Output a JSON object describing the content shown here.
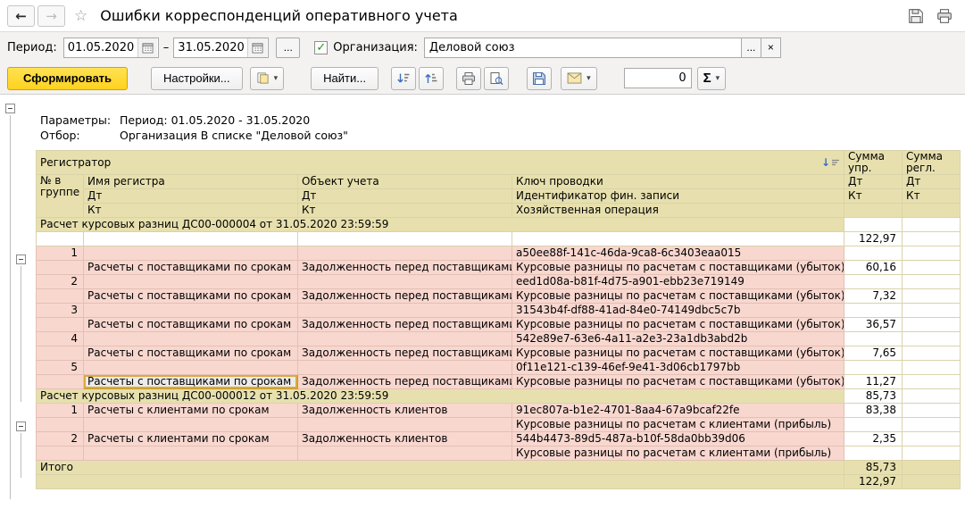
{
  "window": {
    "title": "Ошибки корреспонденций оперативного учета"
  },
  "icons": {
    "back": "←",
    "forward": "→",
    "star": "☆",
    "caret": "▾",
    "close": "×",
    "check": "✓",
    "sort_desc": "↓",
    "dash": "–"
  },
  "filterbar": {
    "period_label": "Период:",
    "date_from": "01.05.2020",
    "date_to": "31.05.2020",
    "period_more": "...",
    "org_label": "Организация:",
    "org_value": "Деловой союз",
    "org_more": "...",
    "org_clear": "×"
  },
  "toolbar": {
    "generate": "Сформировать",
    "settings": "Настройки...",
    "find": "Найти...",
    "counter": "0",
    "sigma": "Σ"
  },
  "report": {
    "params_label": "Параметры:",
    "params_value": "Период: 01.05.2020 - 31.05.2020",
    "selection_label": "Отбор:",
    "selection_value": "Организация В списке \"Деловой союз\"",
    "columns": {
      "registrar": "Регистратор",
      "sum_upr": "Сумма упр.",
      "sum_regl": "Сумма регл.",
      "num_in_group": "№ в группе",
      "register_name": "Имя регистра",
      "object": "Объект учета",
      "key": "Ключ проводки",
      "dt": "Дт",
      "kt": "Кт",
      "fin_id": "Идентификатор фин. записи",
      "operation": "Хозяйственная операция"
    },
    "rows": [
      {
        "kind": "group",
        "text": "Расчет курсовых разниц ДС00-000004 от 31.05.2020 23:59:59",
        "sum1": "",
        "sum2": ""
      },
      {
        "kind": "blank",
        "sum1": "122,97",
        "sum2": ""
      },
      {
        "kind": "err",
        "num": "1",
        "name": "",
        "obj": "",
        "key": "a50ee88f-141c-46da-9ca8-6c3403eaa015",
        "sum1": "",
        "sum2": ""
      },
      {
        "kind": "err",
        "num": "",
        "name": "Расчеты с поставщиками по срокам",
        "obj": "Задолженность перед поставщиками",
        "key": "Курсовые разницы по расчетам с поставщиками (убыток)",
        "sum1": "60,16",
        "sum2": ""
      },
      {
        "kind": "err",
        "num": "2",
        "name": "",
        "obj": "",
        "key": "eed1d08a-b81f-4d75-a901-ebb23e719149",
        "sum1": "",
        "sum2": ""
      },
      {
        "kind": "err",
        "num": "",
        "name": "Расчеты с поставщиками по срокам",
        "obj": "Задолженность перед поставщиками",
        "key": "Курсовые разницы по расчетам с поставщиками (убыток)",
        "sum1": "7,32",
        "sum2": ""
      },
      {
        "kind": "err",
        "num": "3",
        "name": "",
        "obj": "",
        "key": "31543b4f-df88-41ad-84e0-74149dbc5c7b",
        "sum1": "",
        "sum2": ""
      },
      {
        "kind": "err",
        "num": "",
        "name": "Расчеты с поставщиками по срокам",
        "obj": "Задолженность перед поставщиками",
        "key": "Курсовые разницы по расчетам с поставщиками (убыток)",
        "sum1": "36,57",
        "sum2": ""
      },
      {
        "kind": "err",
        "num": "4",
        "name": "",
        "obj": "",
        "key": "542e89e7-63e6-4a11-a2e3-23a1db3abd2b",
        "sum1": "",
        "sum2": ""
      },
      {
        "kind": "err",
        "num": "",
        "name": "Расчеты с поставщиками по срокам",
        "obj": "Задолженность перед поставщиками",
        "key": "Курсовые разницы по расчетам с поставщиками (убыток)",
        "sum1": "7,65",
        "sum2": ""
      },
      {
        "kind": "err",
        "num": "5",
        "name": "",
        "obj": "",
        "key": "0f11e121-c139-46ef-9e41-3d06cb1797bb",
        "sum1": "",
        "sum2": ""
      },
      {
        "kind": "err",
        "num": "",
        "name": "Расчеты с поставщиками по срокам",
        "selected": "name",
        "obj": "Задолженность перед поставщиками",
        "key": "Курсовые разницы по расчетам с поставщиками (убыток)",
        "sum1": "11,27",
        "sum2": ""
      },
      {
        "kind": "group",
        "text": "Расчет курсовых разниц ДС00-000012 от 31.05.2020 23:59:59",
        "sum1": "85,73",
        "sum2": ""
      },
      {
        "kind": "err",
        "num": "1",
        "name": "Расчеты с клиентами по срокам",
        "obj": "Задолженность клиентов",
        "key": "91ec807a-b1e2-4701-8aa4-67a9bcaf22fe",
        "sum1": "83,38",
        "sum2": ""
      },
      {
        "kind": "err",
        "num": "",
        "name": "",
        "obj": "",
        "key": "Курсовые разницы по расчетам с клиентами (прибыль)",
        "sum1": "",
        "sum2": ""
      },
      {
        "kind": "err",
        "num": "2",
        "name": "Расчеты с клиентами по срокам",
        "obj": "Задолженность клиентов",
        "key": "544b4473-89d5-487a-b10f-58da0bb39d06",
        "sum1": "2,35",
        "sum2": ""
      },
      {
        "kind": "err",
        "num": "",
        "name": "",
        "obj": "",
        "key": "Курсовые разницы по расчетам с клиентами (прибыль)",
        "sum1": "",
        "sum2": ""
      },
      {
        "kind": "total",
        "text": "Итого",
        "sum1": "85,73",
        "sum2": ""
      },
      {
        "kind": "total2",
        "sum1": "122,97",
        "sum2": ""
      }
    ]
  }
}
